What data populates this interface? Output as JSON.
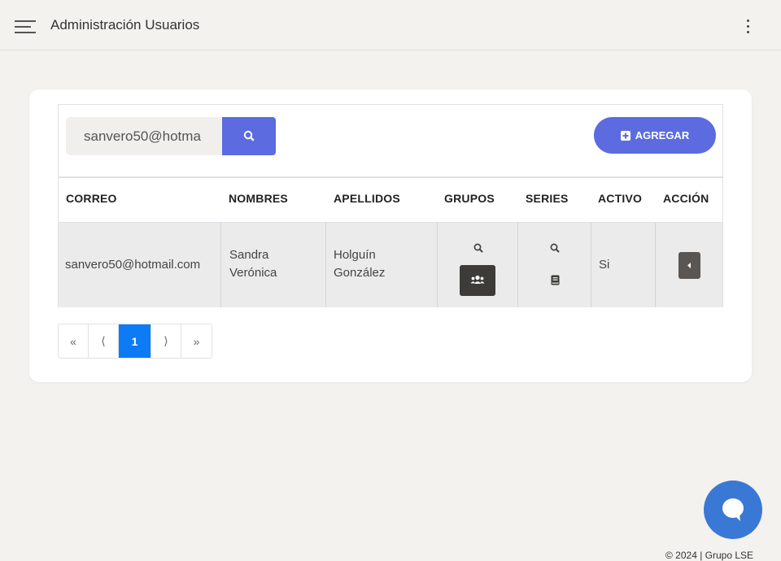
{
  "header": {
    "title": "Administración Usuarios"
  },
  "search": {
    "value": "sanvero50@hotma"
  },
  "toolbar": {
    "add_label": "AGREGAR"
  },
  "table": {
    "columns": [
      "CORREO",
      "NOMBRES",
      "APELLIDOS",
      "GRUPOS",
      "SERIES",
      "ACTIVO",
      "ACCIÓN"
    ],
    "rows": [
      {
        "correo": "sanvero50@hotmail.com",
        "nombres_1": "Sandra",
        "nombres_2": "Verónica",
        "apellidos_1": "Holguín",
        "apellidos_2": "González",
        "activo": "Si"
      }
    ]
  },
  "pagination": {
    "first": "«",
    "prev": "⟨",
    "current": "1",
    "next": "⟩",
    "last": "»"
  },
  "footer": {
    "text": "© 2024 | Grupo LSE"
  },
  "colors": {
    "accent": "#5c6be0",
    "page_active": "#0d7bf5",
    "dark_button": "#3d3b38",
    "chat": "#3a78d6"
  }
}
